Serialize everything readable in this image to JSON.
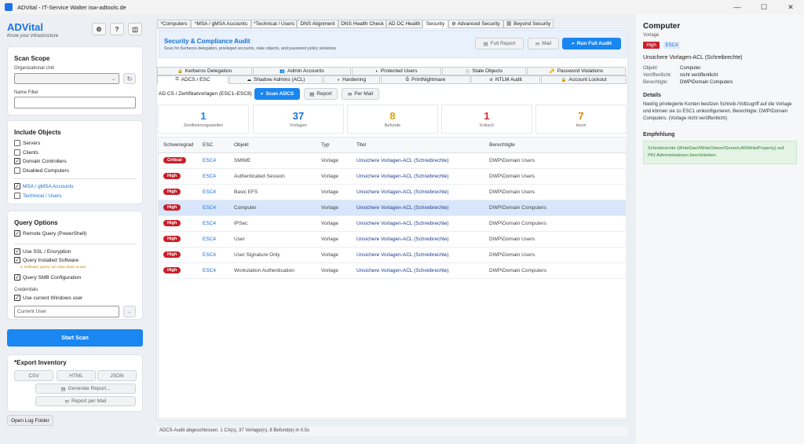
{
  "window": {
    "title": "ADVital - IT-Service Walter isw-adtools.de"
  },
  "brand": {
    "name": "ADVital",
    "tagline": "Know your infrastructure"
  },
  "header_buttons": {
    "gear": "⚙",
    "help": "?",
    "panel": "◫"
  },
  "scan_scope": {
    "title": "Scan Scope",
    "ou_label": "Organizational Unit",
    "ou_value": "",
    "name_filter_label": "Name Filter",
    "name_filter_value": ""
  },
  "include_objects": {
    "title": "Include Objects",
    "items": [
      {
        "label": "Servers",
        "checked": false
      },
      {
        "label": "Clients",
        "checked": false
      },
      {
        "label": "Domain Controllers",
        "checked": true
      },
      {
        "label": "Disabled Computers",
        "checked": false
      },
      {
        "label": "MSA / gMSA Accounts",
        "checked": true
      },
      {
        "label": "Technical / Users",
        "checked": false
      }
    ]
  },
  "query_options": {
    "title": "Query Options",
    "items": [
      {
        "label": "Remote Query (PowerShell)",
        "checked": true
      },
      {
        "label": "Use SSL / Encryption",
        "checked": true
      },
      {
        "label": "Query Installed Software",
        "checked": true
      },
      {
        "label": "Query SMB Configuration",
        "checked": true
      }
    ],
    "software_warning": "⚠ Software query can slow down scans",
    "credentials_label": "Credentials",
    "use_current_user": "Use current Windows user",
    "current_user_placeholder": "Current User",
    "browse": "..."
  },
  "start_scan": "Start Scan",
  "export": {
    "title": "*Export Inventory",
    "csv": "CSV",
    "html": "HTML",
    "json": "JSON",
    "generate_report": "Generate Report...",
    "report_mail": "Report per Mail"
  },
  "open_log": "Open Log Folder",
  "main_tabs": [
    "*Computers",
    "*MSA / gMSA Accounts",
    "*Technical / Users",
    "DNS Alignment",
    "DNS Health Check",
    "AD DC Health",
    "Security",
    "Advanced Security",
    "Beyond Security"
  ],
  "audit_banner": {
    "title": "Security & Compliance Audit",
    "subtitle": "Scan for Kerberos delegation, privileged accounts, stale objects, and password policy violations",
    "full_report": "Full Report",
    "mail": "Mail",
    "run_full_audit": "Run Full Audit"
  },
  "sub_tabs_row1": [
    "Kerberos Delegation",
    "Admin Accounts",
    "Protected Users",
    "Stale Objects",
    "Password Violations"
  ],
  "sub_tabs_row2": [
    "ADCS / ESC",
    "Shadow Admins (ACL)",
    "Hardening",
    "PrintNightmare",
    "NTLM Audit",
    "Account Lockout"
  ],
  "adcs": {
    "heading": "AD CS / Zertifikatvorlagen (ESC1–ESC8)",
    "scan_button": "Scan ADCS",
    "report_button": "Report",
    "mail_button": "Per Mail"
  },
  "stats": [
    {
      "value": "1",
      "caption": "Zertifizierungsstellen",
      "color": "#1a86f0"
    },
    {
      "value": "37",
      "caption": "Vorlagen",
      "color": "#1a6fd1"
    },
    {
      "value": "8",
      "caption": "Befunde",
      "color": "#e0a10b"
    },
    {
      "value": "1",
      "caption": "Kritisch",
      "color": "#d62828"
    },
    {
      "value": "7",
      "caption": "Hoch",
      "color": "#e0871a"
    }
  ],
  "table": {
    "headers": [
      "Schweregrad",
      "ESC",
      "Objekt",
      "Typ",
      "Titel",
      "Berechtigte"
    ],
    "rows": [
      [
        "Critical",
        "ESC4",
        "SMIME",
        "Vorlage",
        "Unsichere Vorlagen-ACL (Schreibrechte)",
        "DWP\\Domain Users"
      ],
      [
        "High",
        "ESC4",
        "Authenticated Session",
        "Vorlage",
        "Unsichere Vorlagen-ACL (Schreibrechte)",
        "DWP\\Domain Users"
      ],
      [
        "High",
        "ESC4",
        "Basic EFS",
        "Vorlage",
        "Unsichere Vorlagen-ACL (Schreibrechte)",
        "DWP\\Domain Users"
      ],
      [
        "High",
        "ESC4",
        "Computer",
        "Vorlage",
        "Unsichere Vorlagen-ACL (Schreibrechte)",
        "DWP\\Domain Computers"
      ],
      [
        "High",
        "ESC4",
        "IPSec",
        "Vorlage",
        "Unsichere Vorlagen-ACL (Schreibrechte)",
        "DWP\\Domain Computers"
      ],
      [
        "High",
        "ESC4",
        "User",
        "Vorlage",
        "Unsichere Vorlagen-ACL (Schreibrechte)",
        "DWP\\Domain Users"
      ],
      [
        "High",
        "ESC4",
        "User Signature Only",
        "Vorlage",
        "Unsichere Vorlagen-ACL (Schreibrechte)",
        "DWP\\Domain Users"
      ],
      [
        "High",
        "ESC4",
        "Workstation Authentication",
        "Vorlage",
        "Unsichere Vorlagen-ACL (Schreibrechte)",
        "DWP\\Domain Computers"
      ]
    ],
    "selected_row": 3
  },
  "status_bar": "ADCS-Audit abgeschlossen. 1 CA(s), 37 Vorlage(n), 8 Befund(e) in 0.5s",
  "detail": {
    "title": "Computer",
    "subtitle": "Vorlage",
    "severity": "High",
    "esc": "ESC4",
    "finding": "Unsichere Vorlagen-ACL (Schreibrechte)",
    "object_label": "Objekt:",
    "object_value": "Computer",
    "published_label": "Veröffentlicht:",
    "published_value": "nicht veröffentlicht",
    "principal_label": "Berechtigte:",
    "principal_value": "DWP\\Domain Computers",
    "details_title": "Details",
    "details_text": "Niedrig privilegierte Konten besitzen Schreib-/Vollzugriff auf die Vorlage und können sie zu ESC1 umkonfigurieren. Berechtigte: DWP\\Domain Computers. (Vorlage nicht veröffentlicht)",
    "recommendation_title": "Empfehlung",
    "recommendation_text": "Schreibrechte (WriteDacl/WriteOwner/GenericAll/WriteProperty) auf PKI-Administratoren beschränken."
  }
}
